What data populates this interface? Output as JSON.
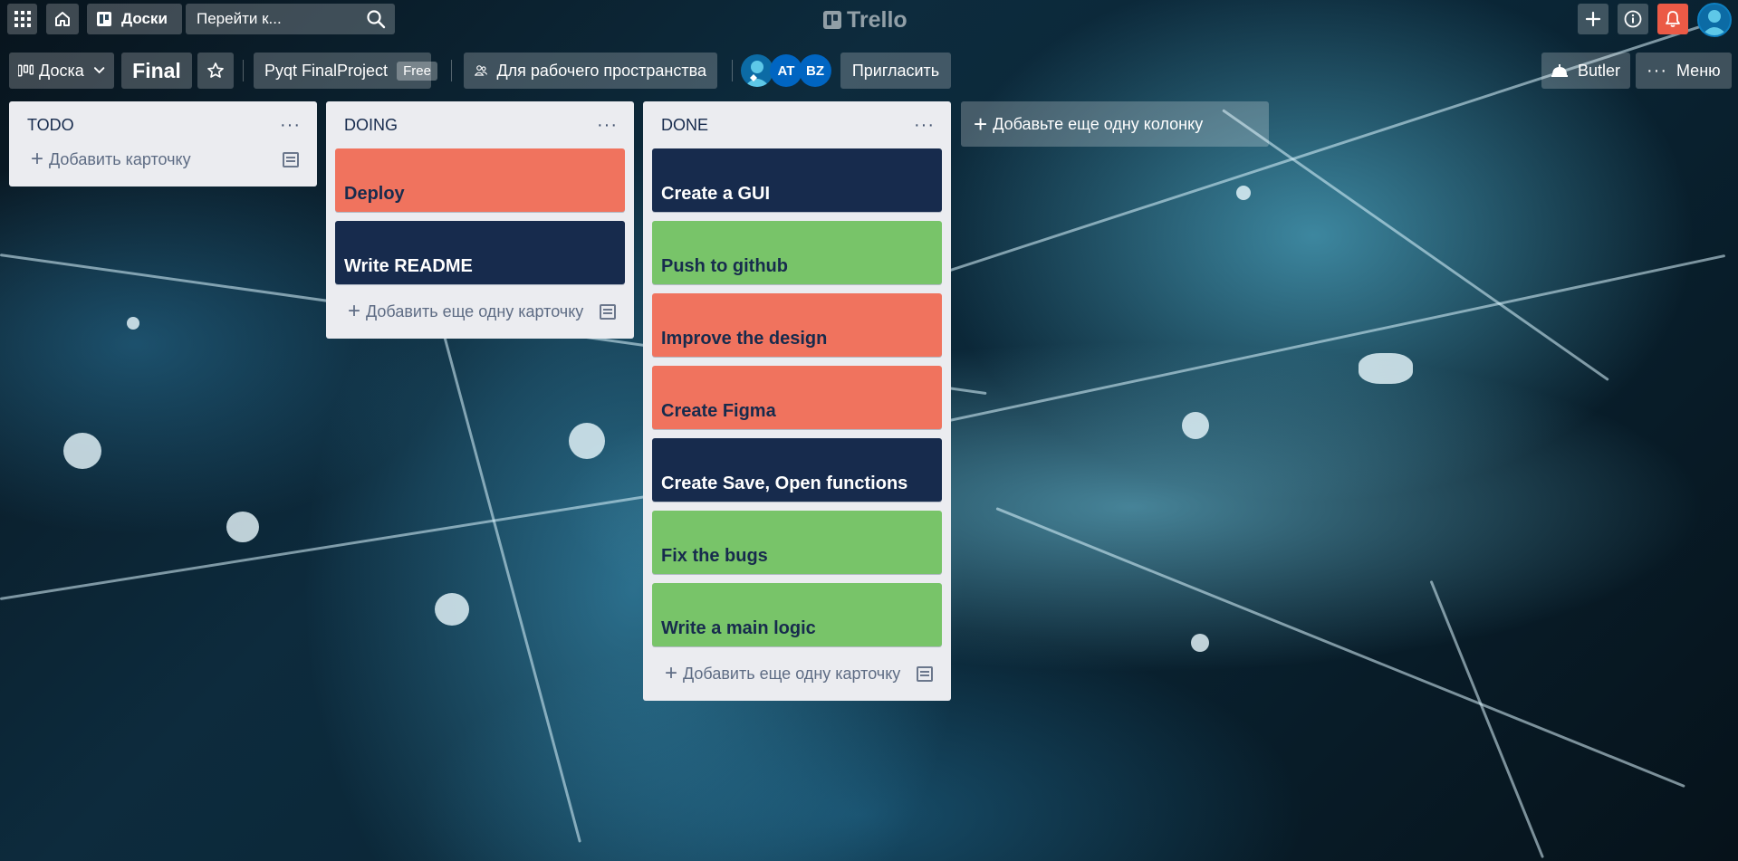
{
  "topbar": {
    "boards_label": "Доски",
    "search_placeholder": "Перейти к...",
    "logo_text": "Trello"
  },
  "board_header": {
    "view_label": "Доска",
    "board_name": "Final",
    "workspace_name": "Pyqt FinalProject",
    "workspace_badge": "Free",
    "visibility_label": "Для рабочего пространства",
    "members": [
      {
        "initials": "",
        "color": "#0c6ba5"
      },
      {
        "initials": "AT",
        "color": "#0065c2"
      },
      {
        "initials": "BZ",
        "color": "#0065c2"
      }
    ],
    "invite_label": "Пригласить",
    "butler_label": "Butler",
    "menu_label": "Меню"
  },
  "lists": [
    {
      "title": "TODO",
      "cards": [],
      "add_card_label": "Добавить карточку"
    },
    {
      "title": "DOING",
      "cards": [
        {
          "title": "Deploy",
          "color": "red"
        },
        {
          "title": "Write README",
          "color": "navy"
        }
      ],
      "add_card_label": "Добавить еще одну карточку"
    },
    {
      "title": "DONE",
      "cards": [
        {
          "title": "Create a GUI",
          "color": "navy"
        },
        {
          "title": "Push to github",
          "color": "green"
        },
        {
          "title": "Improve the design",
          "color": "red"
        },
        {
          "title": "Create Figma",
          "color": "red"
        },
        {
          "title": "Create Save, Open functions",
          "color": "navy"
        },
        {
          "title": "Fix the bugs",
          "color": "green"
        },
        {
          "title": "Write a main logic",
          "color": "green"
        }
      ],
      "add_card_label": "Добавить еще одну карточку"
    }
  ],
  "add_list_label": "Добавьте еще одну колонку",
  "colors": {
    "red": "#f0735e",
    "navy": "#172b4d",
    "green": "#78c469",
    "notification": "#eb5a46"
  }
}
